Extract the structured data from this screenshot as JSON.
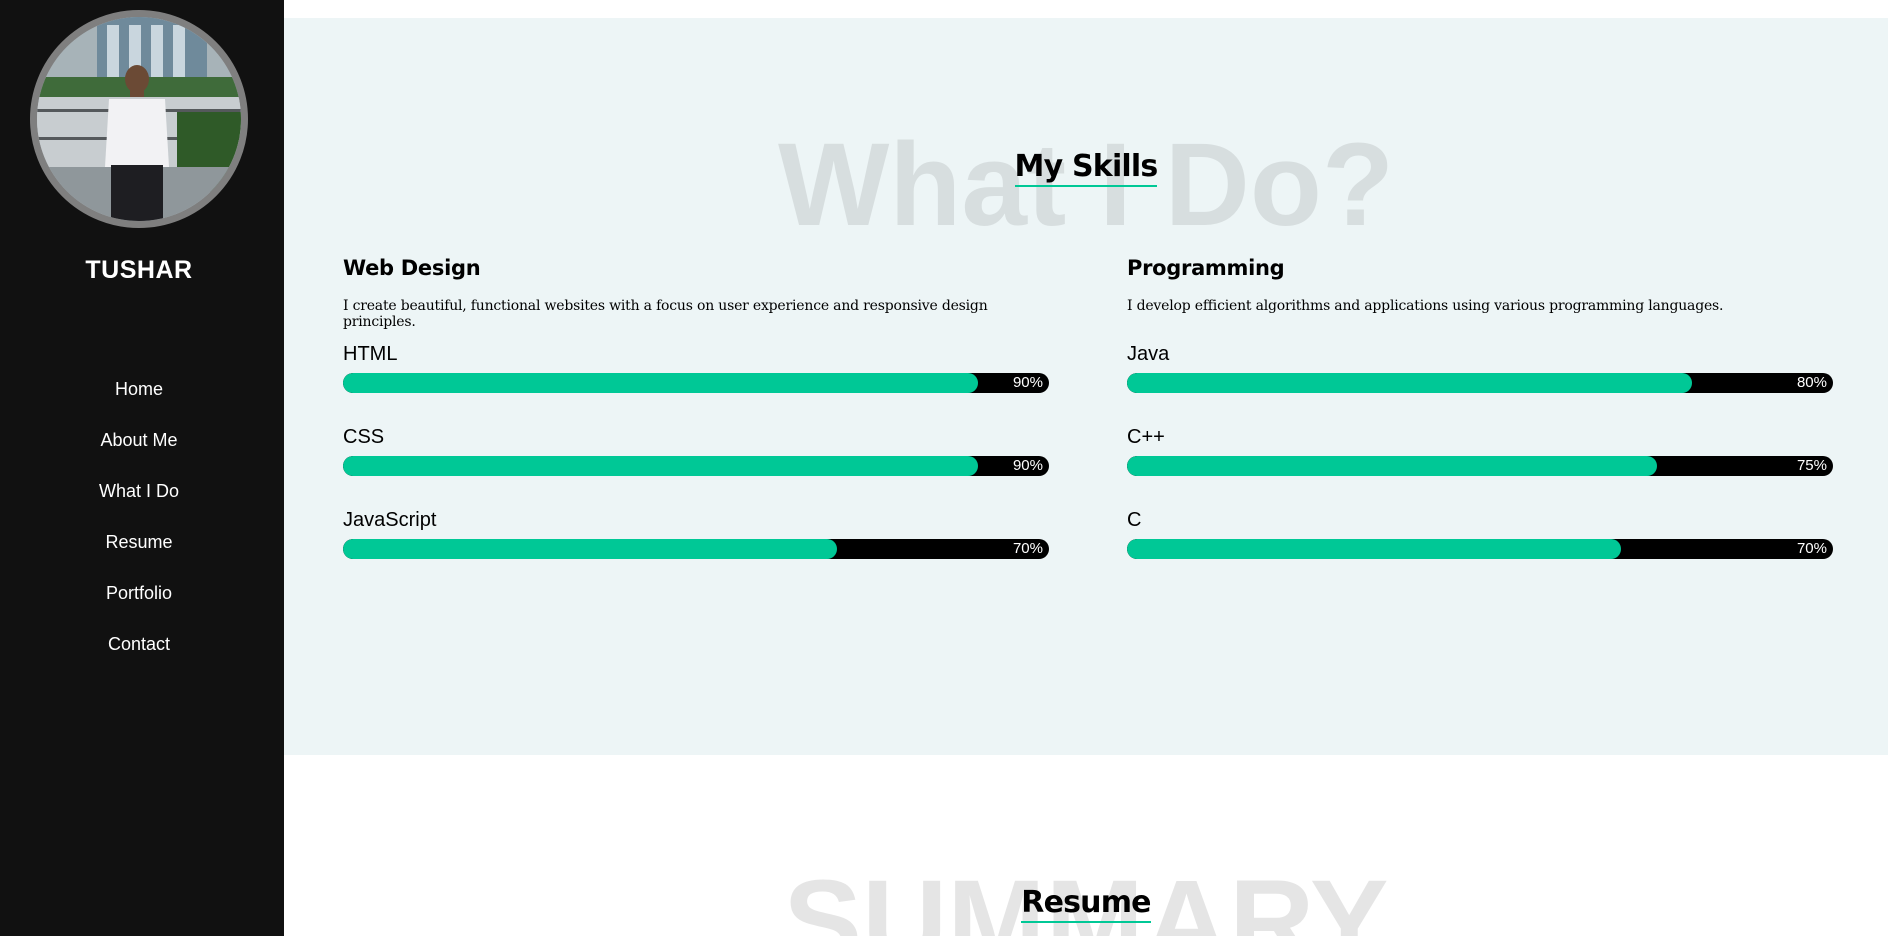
{
  "sidebar": {
    "name": "TUSHAR",
    "nav": [
      "Home",
      "About Me",
      "What I Do",
      "Resume",
      "Portfolio",
      "Contact"
    ]
  },
  "skills_section": {
    "background_word": "What I Do?",
    "title": "My Skills",
    "accent_color": "#00c896",
    "columns": [
      {
        "heading": "Web Design",
        "description": "I create beautiful, functional websites with a focus on user experience and responsive design principles.",
        "skills": [
          {
            "name": "HTML",
            "percent": 90,
            "label": "90%"
          },
          {
            "name": "CSS",
            "percent": 90,
            "label": "90%"
          },
          {
            "name": "JavaScript",
            "percent": 70,
            "label": "70%"
          }
        ]
      },
      {
        "heading": "Programming",
        "description": "I develop efficient algorithms and applications using various programming languages.",
        "skills": [
          {
            "name": "Java",
            "percent": 80,
            "label": "80%"
          },
          {
            "name": "C++",
            "percent": 75,
            "label": "75%"
          },
          {
            "name": "C",
            "percent": 70,
            "label": "70%"
          }
        ]
      }
    ]
  },
  "resume_section": {
    "background_word": "SUMMARY",
    "title": "Resume"
  }
}
